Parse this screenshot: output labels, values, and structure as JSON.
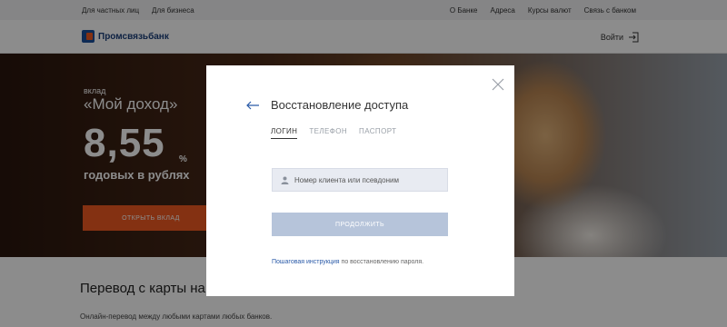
{
  "topbar": {
    "left": [
      "Для частных лиц",
      "Для бизнеса"
    ],
    "right": [
      "О Банке",
      "Адреса",
      "Курсы валют",
      "Связь с банком"
    ]
  },
  "header": {
    "logo_text": "Промсвязьбанк",
    "login_label": "Войти"
  },
  "hero": {
    "kicker": "вклад",
    "title": "«Мой доход»",
    "rate": "8,55",
    "rate_unit": "%",
    "subtitle": "годовых в рублях",
    "cta_label": "ОТКРЫТЬ ВКЛАД"
  },
  "content": {
    "section_title": "Перевод с карты на карту",
    "section_text": "Онлайн-перевод между любыми картами любых банков."
  },
  "modal": {
    "title": "Восстановление доступа",
    "tabs": [
      "ЛОГИН",
      "ТЕЛЕФОН",
      "ПАСПОРТ"
    ],
    "active_tab": "ЛОГИН",
    "field_value": "",
    "field_placeholder": "Номер клиента или псевдоним",
    "submit_label": "ПРОДОЛЖИТЬ",
    "help_link": "Пошаговая инструкция",
    "help_text": " по восстановлению пароля."
  },
  "colors": {
    "brand_blue": "#1b4f9c",
    "brand_orange": "#f15a22",
    "link": "#2a5aa8",
    "disabled_button": "#b6c4da"
  },
  "icons": [
    "logo-icon",
    "login-icon",
    "back-arrow-icon",
    "close-icon",
    "user-icon"
  ]
}
